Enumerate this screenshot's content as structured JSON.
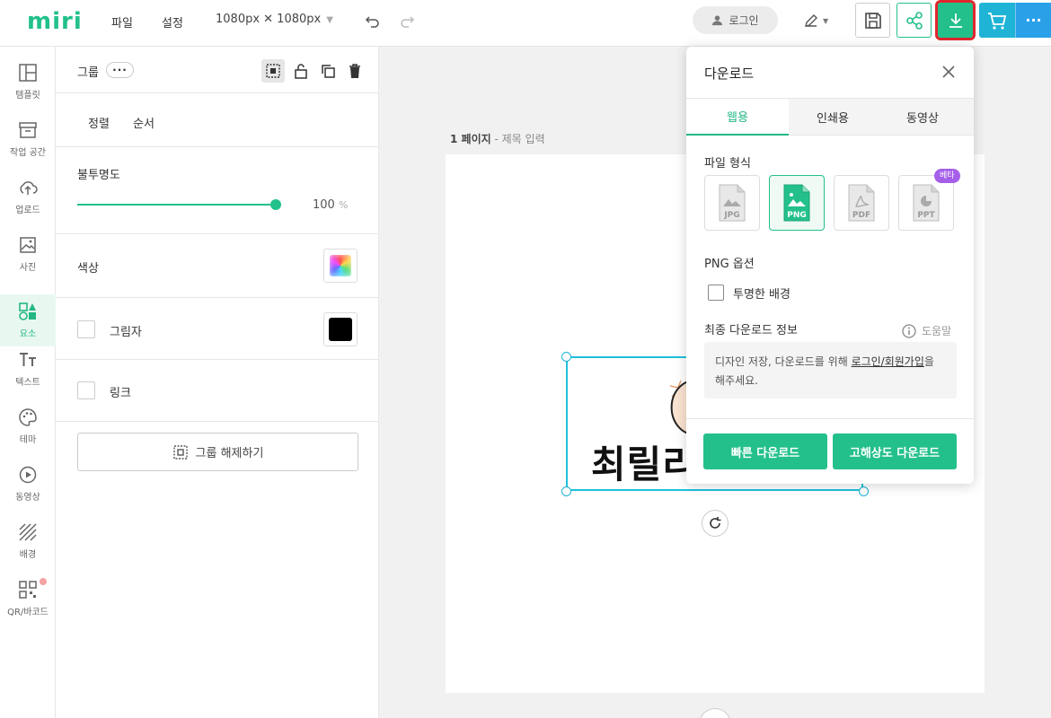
{
  "brand": {
    "logo": "miri",
    "accent": "#23c08b"
  },
  "topbar": {
    "menu_file": "파일",
    "menu_settings": "설정",
    "canvas_size": "1080px ✕ 1080px",
    "login": "로그인"
  },
  "rail": {
    "items": [
      {
        "label": "템플릿",
        "icon": "template-icon"
      },
      {
        "label": "작업 공간",
        "icon": "archive-icon"
      },
      {
        "label": "업로드",
        "icon": "upload-cloud-icon"
      },
      {
        "label": "사진",
        "icon": "photo-icon"
      },
      {
        "label": "요소",
        "icon": "elements-icon"
      },
      {
        "label": "텍스트",
        "icon": "text-icon"
      },
      {
        "label": "테마",
        "icon": "palette-icon"
      },
      {
        "label": "동영상",
        "icon": "play-icon"
      },
      {
        "label": "배경",
        "icon": "background-icon"
      },
      {
        "label": "QR/바코드",
        "icon": "qr-icon"
      }
    ],
    "active": "요소"
  },
  "panel": {
    "title": "그룹",
    "more": "···",
    "tab_align": "정렬",
    "tab_order": "순서",
    "opacity_label": "불투명도",
    "opacity_value": "100",
    "opacity_unit": "%",
    "opacity_fraction": 1.0,
    "color_label": "색상",
    "shadow_label": "그림자",
    "link_label": "링크",
    "ungroup_label": "그룹 해제하기"
  },
  "canvas": {
    "page_number": "1 페이지",
    "page_title_placeholder": "제목 입력",
    "text_content": "최릴리"
  },
  "download": {
    "title": "다운로드",
    "tabs": [
      "웹용",
      "인쇄용",
      "동영상"
    ],
    "active_tab": "웹용",
    "file_format_label": "파일 형식",
    "formats": [
      "JPG",
      "PNG",
      "PDF",
      "PPT"
    ],
    "selected_format": "PNG",
    "beta_badge": "베타",
    "png_options_label": "PNG 옵션",
    "transparent_bg": "투명한 배경",
    "final_info_label": "최종 다운로드 정보",
    "help_label": "도움말",
    "info_prefix": "디자인 저장, 다운로드를 위해 ",
    "info_link": "로그인/회원가입",
    "info_suffix": "을 해주세요.",
    "quick_download": "빠른 다운로드",
    "hq_download": "고해상도 다운로드"
  }
}
